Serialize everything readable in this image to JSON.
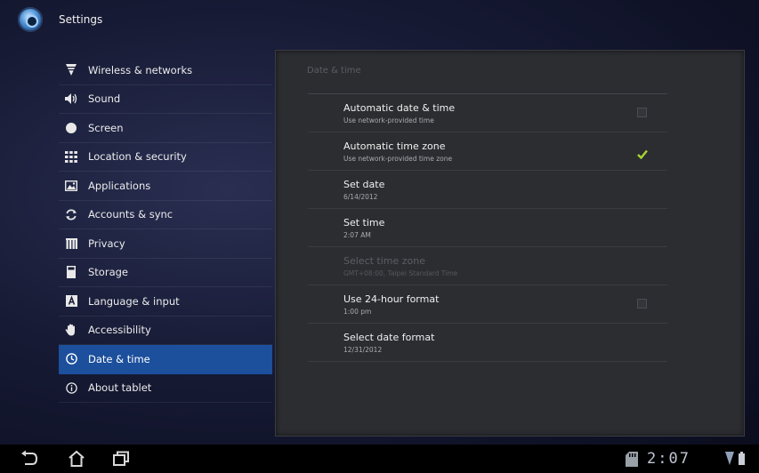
{
  "app": {
    "title": "Settings",
    "icon": "settings-app-icon"
  },
  "nav": {
    "items": [
      {
        "label": "Wireless & networks",
        "icon": "wifi-icon"
      },
      {
        "label": "Sound",
        "icon": "speaker-icon"
      },
      {
        "label": "Screen",
        "icon": "brightness-icon"
      },
      {
        "label": "Location & security",
        "icon": "grid-icon"
      },
      {
        "label": "Applications",
        "icon": "applications-icon"
      },
      {
        "label": "Accounts & sync",
        "icon": "sync-icon"
      },
      {
        "label": "Privacy",
        "icon": "privacy-icon"
      },
      {
        "label": "Storage",
        "icon": "storage-icon"
      },
      {
        "label": "Language & input",
        "icon": "keyboard-letter-icon"
      },
      {
        "label": "Accessibility",
        "icon": "hand-icon"
      },
      {
        "label": "Date & time",
        "icon": "clock-icon",
        "active": true
      },
      {
        "label": "About tablet",
        "icon": "info-icon"
      }
    ]
  },
  "detail": {
    "header": "Date & time",
    "prefs": [
      {
        "title": "Automatic date & time",
        "summary": "Use network-provided time",
        "checkbox": true,
        "checked": false
      },
      {
        "title": "Automatic time zone",
        "summary": "Use network-provided time zone",
        "checkbox": true,
        "checked": true
      },
      {
        "title": "Set date",
        "summary": "6/14/2012"
      },
      {
        "title": "Set time",
        "summary": "2:07 AM"
      },
      {
        "title": "Select time zone",
        "summary": "GMT+08:00, Taipei Standard Time",
        "disabled": true
      },
      {
        "title": "Use 24-hour format",
        "summary": "1:00 pm",
        "checkbox": true,
        "checked": false
      },
      {
        "title": "Select date format",
        "summary": "12/31/2012"
      }
    ]
  },
  "system_bar": {
    "clock": "2:07",
    "icons": [
      "back-icon",
      "home-icon",
      "recent-apps-icon",
      "sd-card-icon",
      "signal-icon",
      "battery-icon"
    ]
  },
  "colors": {
    "accent": "#1c4f9c",
    "check": "#a8d632",
    "panel": "#2c2d31",
    "clock": "#bfc6d2"
  }
}
